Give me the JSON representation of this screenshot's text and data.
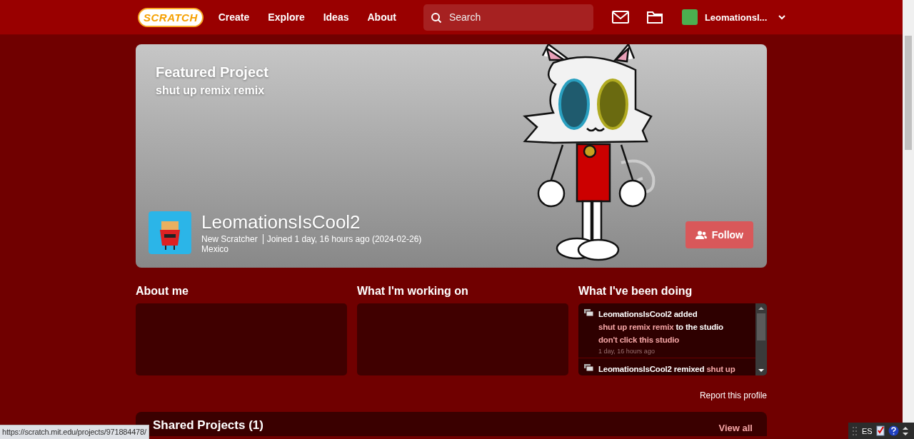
{
  "nav": {
    "logo": "SCRATCH",
    "links": [
      "Create",
      "Explore",
      "Ideas",
      "About"
    ],
    "search": {
      "placeholder": "Search"
    },
    "username": "LeomationsI..."
  },
  "banner": {
    "heading": "Featured Project",
    "project_title": "shut up remix remix",
    "username": "LeomationsIsCool2",
    "role": "New Scratcher",
    "joined": "Joined 1 day, 16 hours ago (2024-02-26)",
    "location": "Mexico",
    "follow_button": "Follow"
  },
  "sections": [
    {
      "kind": "text",
      "title": "About me"
    },
    {
      "kind": "text",
      "title": "What I'm working on"
    },
    {
      "kind": "activity",
      "title": "What I've been doing",
      "items": [
        {
          "segments": [
            {
              "kind": "user",
              "text": "LeomationsIsCool2"
            },
            {
              "kind": "plain",
              "text": "added"
            },
            {
              "kind": "link",
              "text": "shut up remix remix"
            },
            {
              "kind": "plain",
              "text": "to the studio"
            },
            {
              "kind": "link",
              "text": "don't click this studio"
            }
          ],
          "time": "1 day, 16 hours ago"
        },
        {
          "segments": [
            {
              "kind": "user",
              "text": "LeomationsIsCool2"
            },
            {
              "kind": "plain",
              "text": "remixed"
            },
            {
              "kind": "link",
              "text": "shut up"
            }
          ]
        }
      ]
    }
  ],
  "report_link": "Report this profile",
  "shared_projects": {
    "title": "Shared Projects (1)",
    "view_all": "View all"
  },
  "status_url": "https://scratch.mit.edu/projects/971884478/",
  "tray": {
    "language": "ES"
  }
}
